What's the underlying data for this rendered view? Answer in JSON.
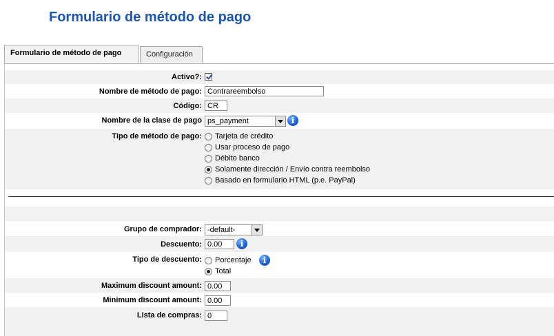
{
  "page": {
    "title": "Formulario de método de pago"
  },
  "tabs": [
    {
      "label": "Formulario de método de pago",
      "active": true
    },
    {
      "label": "Configuración",
      "active": false
    }
  ],
  "form": {
    "active_label": "Activo?:",
    "active_checked": true,
    "name_label": "Nombre de método de pago:",
    "name_value": "Contrareembolso",
    "code_label": "Código:",
    "code_value": "CR",
    "class_label": "Nombre de la clase de pago",
    "class_value": "ps_payment",
    "type_label": "Tipo de método de pago:",
    "type_options": [
      "Tarjeta de crédito",
      "Usar proceso de pago",
      "Débito banco",
      "Solamente dirección / Envío contra reembolso",
      "Basado en formulario HTML (p.e. PayPal)"
    ],
    "type_selected": "Solamente dirección / Envío contra reembolso",
    "group_label": "Grupo de comprador:",
    "group_value": "-default-",
    "discount_label": "Descuento:",
    "discount_value": "0.00",
    "discount_type_label": "Tipo de descuento:",
    "discount_type_options": [
      "Porcentaje",
      "Total"
    ],
    "discount_type_selected": "Total",
    "max_label": "Maximum discount amount:",
    "max_value": "0.00",
    "min_label": "Minimum discount amount:",
    "min_value": "0.00",
    "order_label": "Lista de compras:",
    "order_value": "0"
  },
  "colors": {
    "title": "#1c56b4",
    "stripe": "#f1f1f1",
    "info_icon": "#1c5fd0"
  },
  "icons": {
    "info": "info-icon"
  }
}
